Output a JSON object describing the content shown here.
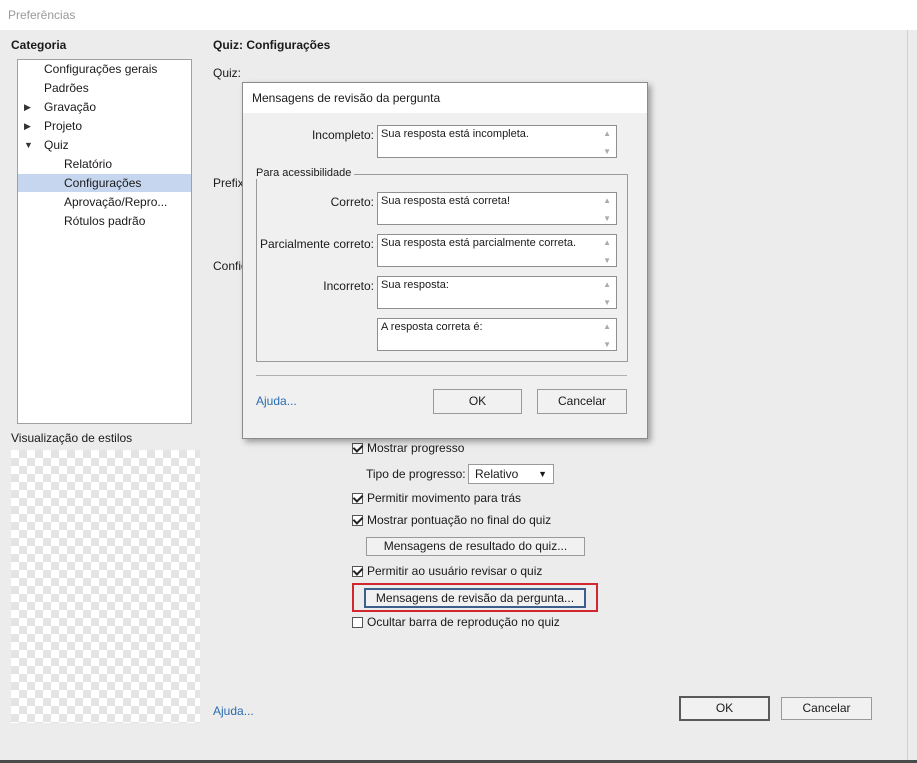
{
  "window": {
    "title": "Preferências"
  },
  "sidebar": {
    "heading": "Categoria",
    "items": [
      {
        "label": "Configurações gerais",
        "level": 0
      },
      {
        "label": "Padrões",
        "level": 0
      },
      {
        "label": "Gravação",
        "level": 0,
        "expander": "collapsed"
      },
      {
        "label": "Projeto",
        "level": 0,
        "expander": "collapsed"
      },
      {
        "label": "Quiz",
        "level": 0,
        "expander": "expanded"
      },
      {
        "label": "Relatório",
        "level": 1
      },
      {
        "label": "Configurações",
        "level": 1,
        "selected": true
      },
      {
        "label": "Aprovação/Repro...",
        "level": 1
      },
      {
        "label": "Rótulos padrão",
        "level": 1
      }
    ],
    "style_preview_label": "Visualização de estilos"
  },
  "main": {
    "heading": "Quiz: Configurações",
    "partial_labels": {
      "quiz": "Quiz:",
      "prefix": "Prefix",
      "config": "Config"
    },
    "options": {
      "show_progress": {
        "label": "Mostrar progresso",
        "checked": true
      },
      "progress_type_label": "Tipo de progresso:",
      "progress_type_value": "Relativo",
      "allow_backward": {
        "label": "Permitir movimento para trás",
        "checked": true
      },
      "show_score": {
        "label": "Mostrar pontuação no final do quiz",
        "checked": true
      },
      "result_messages_button": "Mensagens de resultado do quiz...",
      "allow_review": {
        "label": "Permitir ao usuário revisar o quiz",
        "checked": true
      },
      "review_messages_button": "Mensagens de revisão da pergunta...",
      "hide_playbar": {
        "label": "Ocultar barra de reprodução no quiz",
        "checked": false
      }
    },
    "help_link": "Ajuda...",
    "ok_button": "OK",
    "cancel_button": "Cancelar"
  },
  "dialog": {
    "title": "Mensagens de revisão da pergunta",
    "incomplete_label": "Incompleto:",
    "incomplete_value": "Sua resposta está incompleta.",
    "accessibility_group": "Para acessibilidade",
    "correct_label": "Correto:",
    "correct_value": "Sua resposta está correta!",
    "partial_label": "Parcialmente correto:",
    "partial_value": "Sua resposta está parcialmente correta.",
    "incorrect_label": "Incorreto:",
    "incorrect_value": "Sua resposta:",
    "correct_answer_value": "A resposta correta é:",
    "help_link": "Ajuda...",
    "ok_button": "OK",
    "cancel_button": "Cancelar"
  },
  "colors": {
    "highlight": "#d0282e",
    "selection": "#c6d6ee",
    "link": "#2a6cb0"
  }
}
